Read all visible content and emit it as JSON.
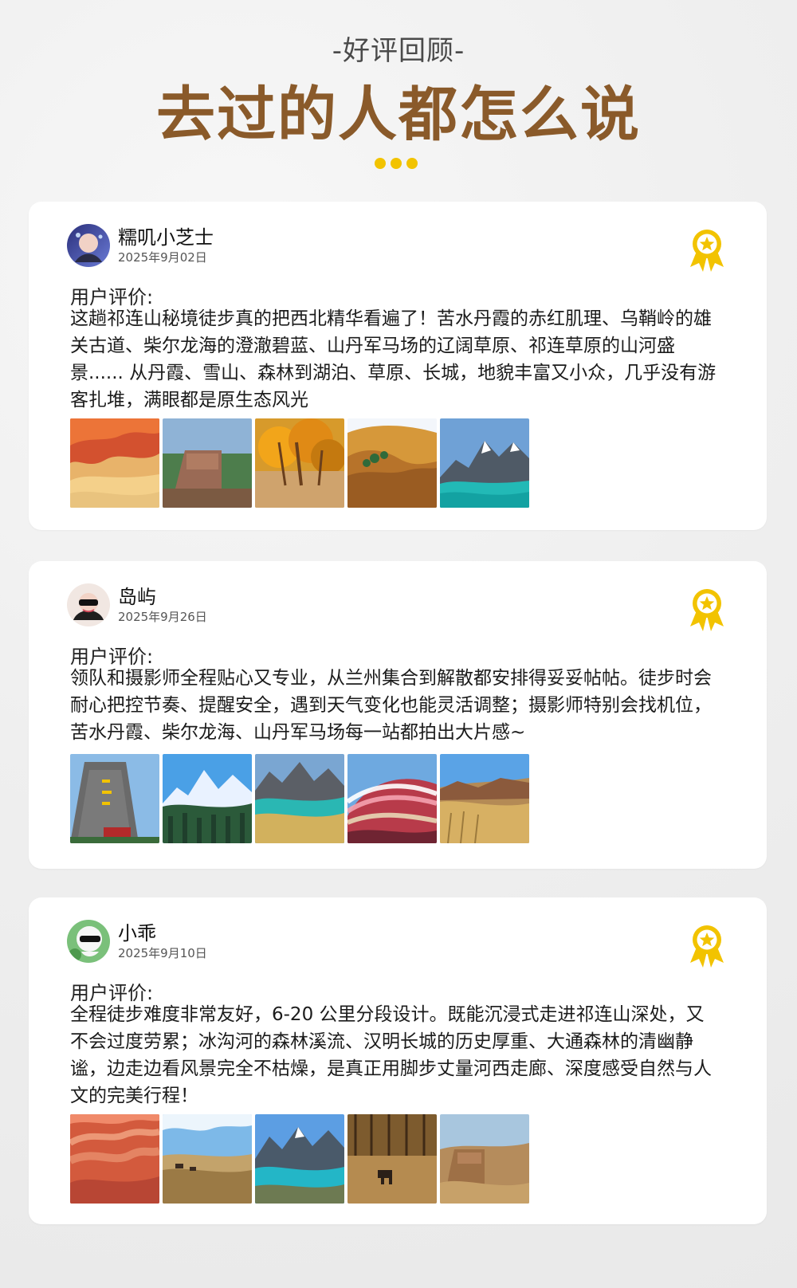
{
  "header": {
    "subtitle": "-好评回顾-",
    "title": "去过的人都怎么说"
  },
  "colors": {
    "title_brown": "#8a5a2a",
    "accent_yellow": "#f2c300",
    "card_bg": "#ffffff"
  },
  "reviews": [
    {
      "name": "糯叽小芝士",
      "date": "2025年9月02日",
      "label": "用户评价:",
      "text": "这趟祁连山秘境徒步真的把西北精华看遍了！苦水丹霞的赤红肌理、乌鞘岭的雄关古道、柴尔龙海的澄澈碧蓝、山丹军马场的辽阔草原、祁连草原的山河盛景...... 从丹霞、雪山、森林到湖泊、草原、长城，地貌丰富又小众，几乎没有游客扎堆，满眼都是原生态风光",
      "badge_icon": "medal-star-icon"
    },
    {
      "name": "岛屿",
      "date": "2025年9月26日",
      "label": "用户评价:",
      "text": "领队和摄影师全程贴心又专业，从兰州集合到解散都安排得妥妥帖帖。徒步时会耐心把控节奏、提醒安全，遇到天气变化也能灵活调整；摄影师特别会找机位，苦水丹霞、柴尔龙海、山丹军马场每一站都拍出大片感~",
      "badge_icon": "medal-star-icon"
    },
    {
      "name": "小乖",
      "date": "2025年9月10日",
      "label": "用户评价:",
      "text": "全程徒步难度非常友好，6-20 公里分段设计。既能沉浸式走进祁连山深处，又不会过度劳累；冰沟河的森林溪流、汉明长城的历史厚重、大通森林的清幽静谧，边走边看风景完全不枯燥，是真正用脚步丈量河西走廊、深度感受自然与人文的完美行程！",
      "badge_icon": "medal-star-icon"
    }
  ]
}
